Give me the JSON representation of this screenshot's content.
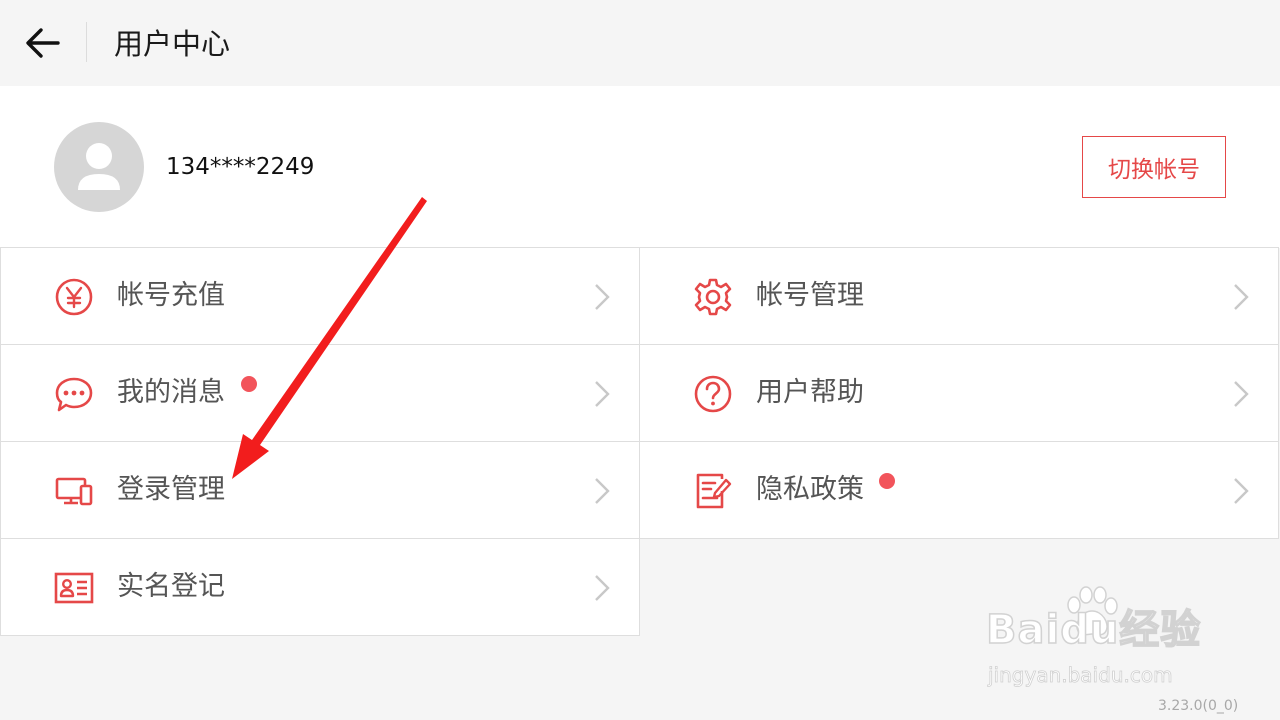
{
  "header": {
    "title": "用户中心",
    "back_icon": "arrow-left-icon"
  },
  "profile": {
    "phone": "134****2249",
    "switch_label": "切换帐号",
    "avatar_icon": "user-avatar-icon"
  },
  "menu": {
    "recharge": {
      "label": "帐号充值",
      "icon": "yuan-icon"
    },
    "account_manage": {
      "label": "帐号管理",
      "icon": "gear-icon"
    },
    "messages": {
      "label": "我的消息",
      "icon": "chat-bubble-icon",
      "badge": true
    },
    "help": {
      "label": "用户帮助",
      "icon": "question-icon"
    },
    "login_manage": {
      "label": "登录管理",
      "icon": "devices-icon"
    },
    "privacy": {
      "label": "隐私政策",
      "icon": "policy-icon",
      "badge": true
    },
    "realname": {
      "label": "实名登记",
      "icon": "id-card-icon"
    }
  },
  "watermark": {
    "logo": "Baidu经验",
    "url": "jingyan.baidu.com"
  },
  "version": "3.23.0(0_0)",
  "colors": {
    "accent": "#e54848",
    "badge": "#f2545b",
    "annotation_arrow": "#f21d1d"
  }
}
